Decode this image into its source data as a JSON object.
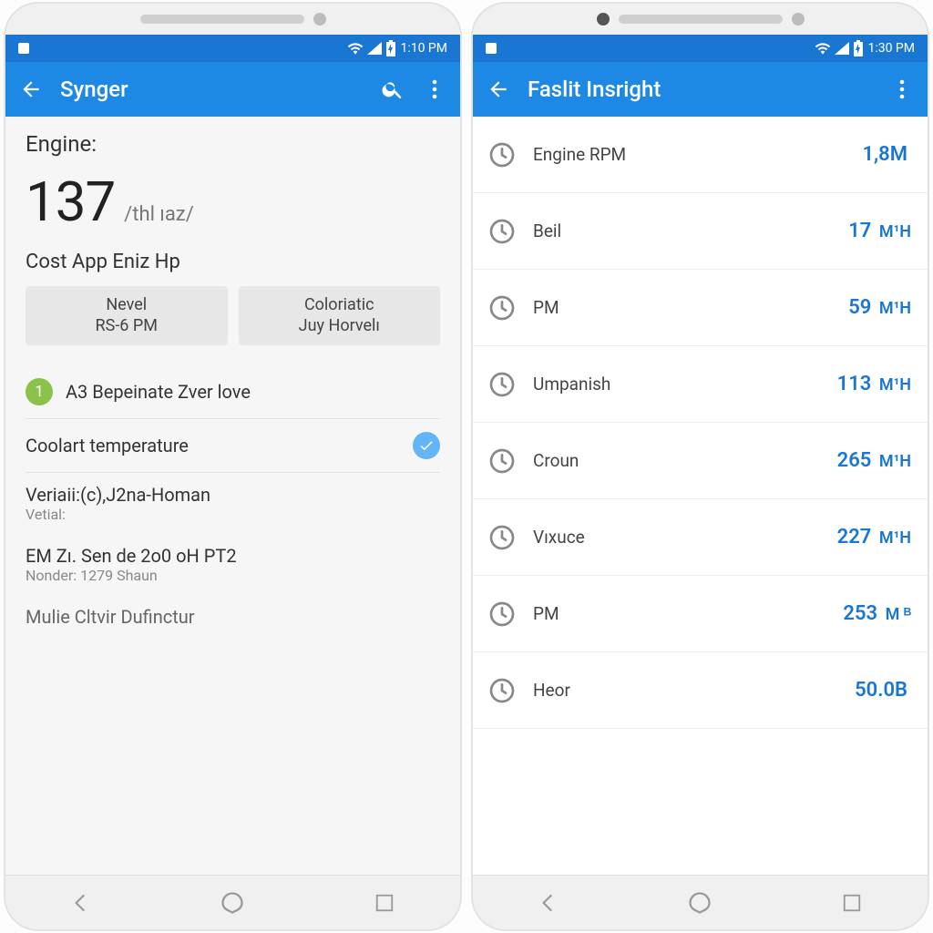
{
  "left": {
    "status": {
      "time": "1:10 PM"
    },
    "appbar": {
      "title": "Synger"
    },
    "engine_label": "Engine:",
    "engine_value": "137",
    "engine_unit": "/thl ıaz/",
    "subhead": "Cost App Eniz Hp",
    "btn1_line1": "Nevel",
    "btn1_line2": "RS-6 PM",
    "btn2_line1": "Coloriatic",
    "btn2_line2": "Juy Horvelı",
    "badge_num": "1",
    "badge_text": "A3 Bepeinate Zver love",
    "coolant_label": "Coolart temperature",
    "veriai_title": "Veriaii:(c),J2na-Homan",
    "veriai_sub": "Vetial:",
    "em_title": "EM Zı. Sen de 2o0 oH PT2",
    "em_sub": "Nonder: 1279 Shaun",
    "cut_title": "Mulie Cltvir Dufinctur"
  },
  "right": {
    "status": {
      "time": "1:30 PM"
    },
    "appbar": {
      "title": "Faslit Insright"
    },
    "rows": [
      {
        "label": "Engine RPM",
        "value": "1,8M",
        "unit": ""
      },
      {
        "label": "Beil",
        "value": "17",
        "unit": "M¹H"
      },
      {
        "label": "PM",
        "value": "59",
        "unit": "M¹H"
      },
      {
        "label": "Umpanish",
        "value": "113",
        "unit": "M¹H"
      },
      {
        "label": "Croun",
        "value": "265",
        "unit": "M¹H"
      },
      {
        "label": "Vıxuce",
        "value": "227",
        "unit": "M¹H"
      },
      {
        "label": "PM",
        "value": "253",
        "unit": "M ᴮ"
      },
      {
        "label": "Heor",
        "value": "50.0B",
        "unit": ""
      }
    ]
  }
}
